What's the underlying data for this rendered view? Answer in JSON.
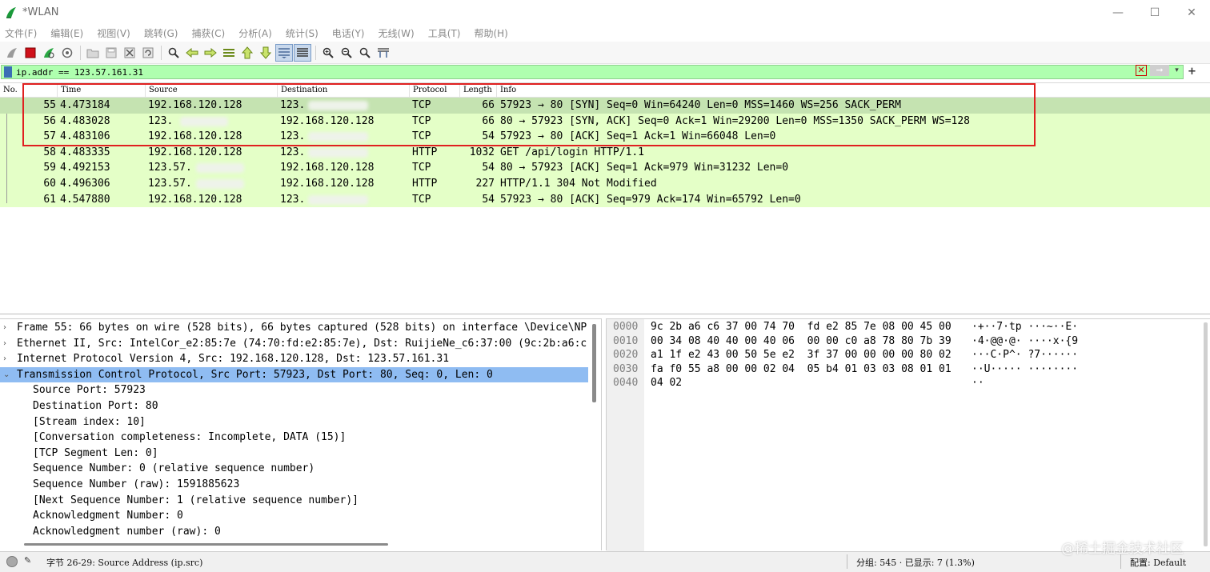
{
  "window": {
    "title": "*WLAN",
    "minimize": "—",
    "maximize": "☐",
    "close": "✕"
  },
  "menu": [
    "文件(F)",
    "编辑(E)",
    "视图(V)",
    "跳转(G)",
    "捕获(C)",
    "分析(A)",
    "统计(S)",
    "电话(Y)",
    "无线(W)",
    "工具(T)",
    "帮助(H)"
  ],
  "toolbar": {
    "icons": [
      "shark-fin-icon",
      "stop-capture-icon",
      "restart-capture-icon",
      "capture-options-icon",
      "sep",
      "open-file-icon",
      "save-file-icon",
      "close-file-icon",
      "reload-file-icon",
      "sep",
      "find-packet-icon",
      "go-back-icon",
      "go-forward-icon",
      "go-to-packet-icon",
      "go-first-icon",
      "go-last-icon",
      "auto-scroll-icon",
      "colorize-icon",
      "sep",
      "zoom-in-icon",
      "zoom-out-icon",
      "normal-size-icon",
      "resize-columns-icon"
    ]
  },
  "filter": {
    "value": "ip.addr == 123.57.161.31",
    "apply_arrow": "➞",
    "dropdown": "▾",
    "add": "+"
  },
  "packet_list": {
    "columns": [
      "No.",
      "Time",
      "Source",
      "Destination",
      "Protocol",
      "Length",
      "Info"
    ],
    "rows": [
      {
        "no": "55",
        "time": "4.473184",
        "source": "192.168.120.128",
        "destination": "123.",
        "protocol": "TCP",
        "length": "66",
        "info": "57923 → 80 [SYN] Seq=0 Win=64240 Len=0 MSS=1460 WS=256 SACK_PERM",
        "selected": true
      },
      {
        "no": "56",
        "time": "4.483028",
        "source": "123.",
        "destination": "192.168.120.128",
        "protocol": "TCP",
        "length": "66",
        "info": "80 → 57923 [SYN, ACK] Seq=0 Ack=1 Win=29200 Len=0 MSS=1350 SACK_PERM WS=128",
        "selected": false
      },
      {
        "no": "57",
        "time": "4.483106",
        "source": "192.168.120.128",
        "destination": "123.",
        "protocol": "TCP",
        "length": "54",
        "info": "57923 → 80 [ACK] Seq=1 Ack=1 Win=66048 Len=0",
        "selected": false
      },
      {
        "no": "58",
        "time": "4.483335",
        "source": "192.168.120.128",
        "destination": "123.",
        "protocol": "HTTP",
        "length": "1032",
        "info": "GET /api/login HTTP/1.1",
        "selected": false
      },
      {
        "no": "59",
        "time": "4.492153",
        "source": "123.57.",
        "destination": "192.168.120.128",
        "protocol": "TCP",
        "length": "54",
        "info": "80 → 57923 [ACK] Seq=1 Ack=979 Win=31232 Len=0",
        "selected": false
      },
      {
        "no": "60",
        "time": "4.496306",
        "source": "123.57.",
        "destination": "192.168.120.128",
        "protocol": "HTTP",
        "length": "227",
        "info": "HTTP/1.1 304 Not Modified",
        "selected": false
      },
      {
        "no": "61",
        "time": "4.547880",
        "source": "192.168.120.128",
        "destination": "123.",
        "protocol": "TCP",
        "length": "54",
        "info": "57923 → 80 [ACK] Seq=979 Ack=174 Win=65792 Len=0",
        "selected": false
      }
    ]
  },
  "details": {
    "rows": [
      {
        "arrow": "›",
        "text": "Frame 55: 66 bytes on wire (528 bits), 66 bytes captured (528 bits) on interface \\Device\\NP",
        "indent": 0,
        "selected": false
      },
      {
        "arrow": "›",
        "text": "Ethernet II, Src: IntelCor_e2:85:7e (74:70:fd:e2:85:7e), Dst: RuijieNe_c6:37:00 (9c:2b:a6:c",
        "indent": 0,
        "selected": false
      },
      {
        "arrow": "›",
        "text": "Internet Protocol Version 4, Src: 192.168.120.128, Dst: 123.57.161.31",
        "indent": 0,
        "selected": false
      },
      {
        "arrow": "⌄",
        "text": "Transmission Control Protocol, Src Port: 57923, Dst Port: 80, Seq: 0, Len: 0",
        "indent": 0,
        "selected": true
      },
      {
        "arrow": "",
        "text": "Source Port: 57923",
        "indent": 1,
        "selected": false
      },
      {
        "arrow": "",
        "text": "Destination Port: 80",
        "indent": 1,
        "selected": false
      },
      {
        "arrow": "",
        "text": "[Stream index: 10]",
        "indent": 1,
        "selected": false
      },
      {
        "arrow": "",
        "text": "[Conversation completeness: Incomplete, DATA (15)]",
        "indent": 1,
        "selected": false
      },
      {
        "arrow": "",
        "text": "[TCP Segment Len: 0]",
        "indent": 1,
        "selected": false
      },
      {
        "arrow": "",
        "text": "Sequence Number: 0    (relative sequence number)",
        "indent": 1,
        "selected": false
      },
      {
        "arrow": "",
        "text": "Sequence Number (raw): 1591885623",
        "indent": 1,
        "selected": false
      },
      {
        "arrow": "",
        "text": "[Next Sequence Number: 1    (relative sequence number)]",
        "indent": 1,
        "selected": false
      },
      {
        "arrow": "",
        "text": "Acknowledgment Number: 0",
        "indent": 1,
        "selected": false
      },
      {
        "arrow": "",
        "text": "Acknowledgment number (raw): 0",
        "indent": 1,
        "selected": false
      }
    ]
  },
  "hex": {
    "rows": [
      {
        "offset": "0000",
        "bytes": "9c 2b a6 c6 37 00 74 70  fd e2 85 7e 08 00 45 00",
        "ascii": "·+··7·tp ···~··E·"
      },
      {
        "offset": "0010",
        "bytes": "00 34 08 40 40 00 40 06  00 00 c0 a8 78 80 7b 39",
        "ascii": "·4·@@·@· ····x·{9"
      },
      {
        "offset": "0020",
        "bytes": "a1 1f e2 43 00 50 5e e2  3f 37 00 00 00 00 80 02",
        "ascii": "···C·P^· ?7······"
      },
      {
        "offset": "0030",
        "bytes": "fa f0 55 a8 00 00 02 04  05 b4 01 03 03 08 01 01",
        "ascii": "··U····· ········"
      },
      {
        "offset": "0040",
        "bytes": "04 02",
        "ascii": "··"
      }
    ]
  },
  "status": {
    "field_info": "字节 26-29: Source Address (ip.src)",
    "packets": "分组: 545 · 已显示: 7 (1.3%)",
    "profile": "配置: Default"
  },
  "watermark": "@稀土掘金技术社区",
  "colors": {
    "filter_bg": "#afffaf",
    "row_bg": "#e4ffc7",
    "row_selected_bg": "#c5e3b1",
    "detail_selected_bg": "#8fbcf2",
    "highlight_border": "#e02020"
  }
}
